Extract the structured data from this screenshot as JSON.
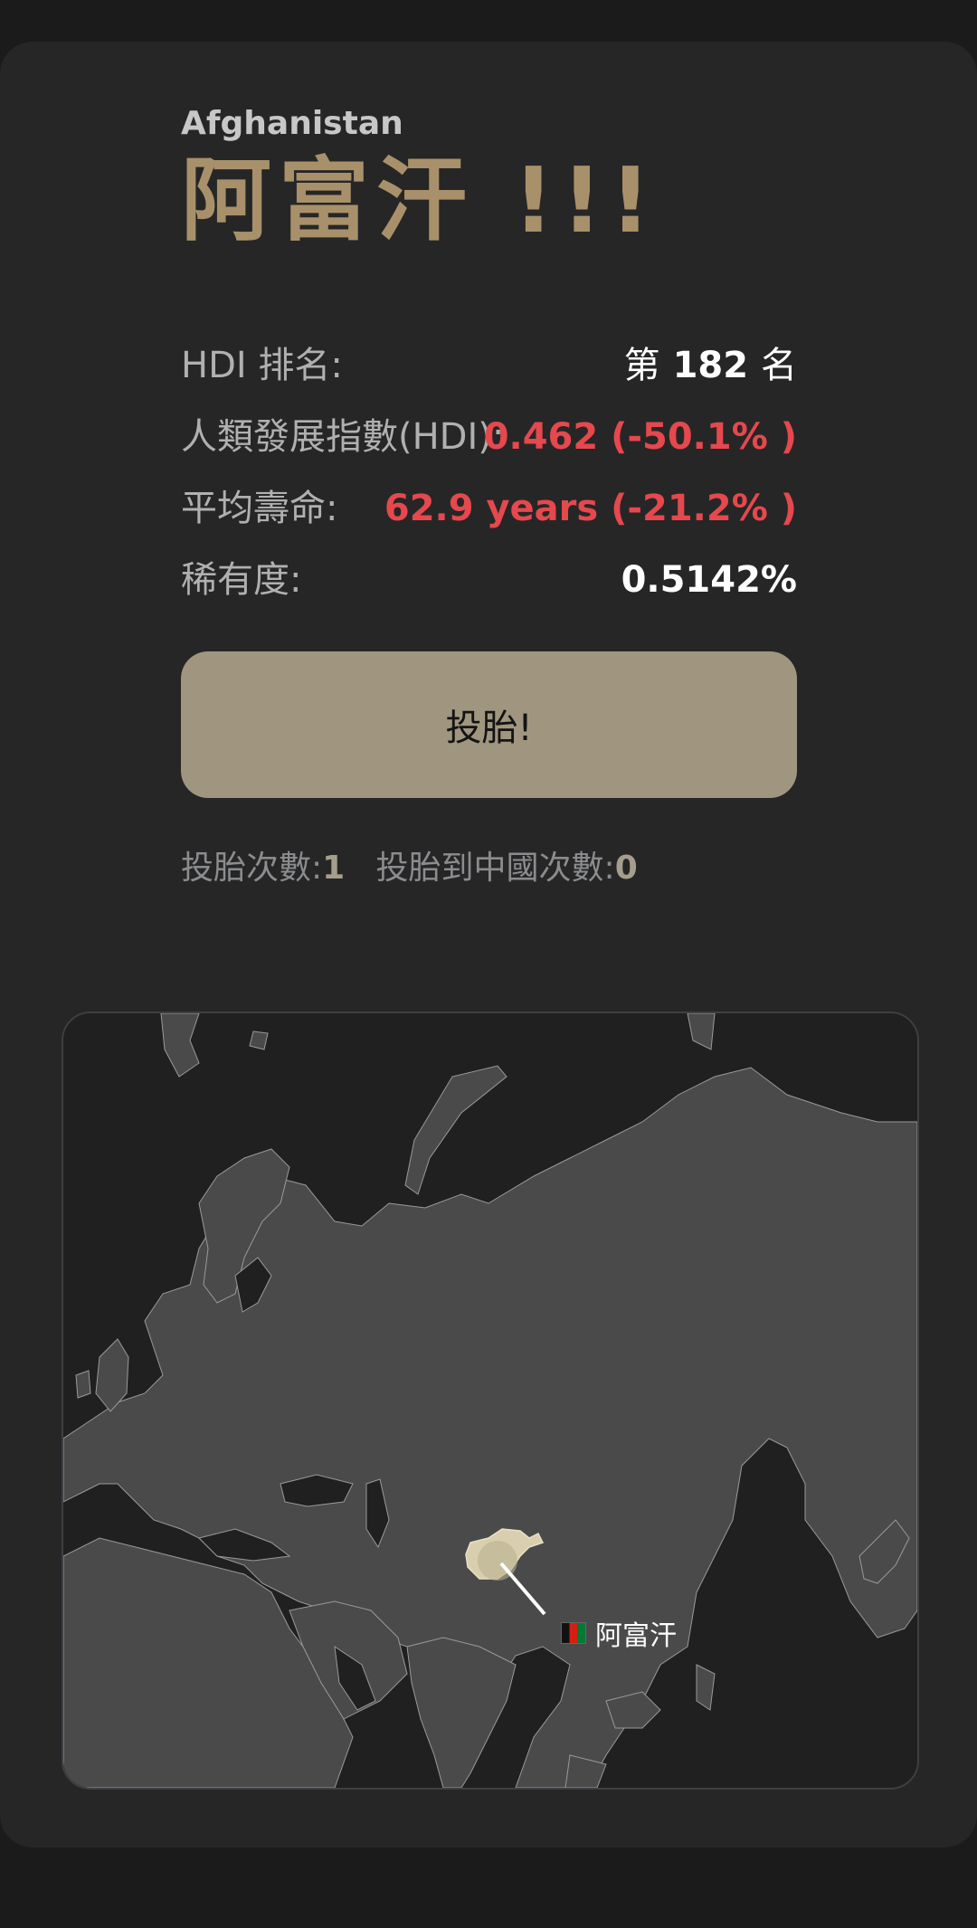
{
  "country": {
    "name_en": "Afghanistan",
    "name_zh": "阿富汗 !!!"
  },
  "stats": {
    "hdi_rank": {
      "label": "HDI 排名:",
      "prefix": "第",
      "value": "182",
      "suffix": "名"
    },
    "hdi": {
      "label": "人類發展指數(HDI):",
      "value": "0.462 (-50.1% )"
    },
    "life_expectancy": {
      "label": "平均壽命:",
      "value": "62.9 years (-21.2% )"
    },
    "rarity": {
      "label": "稀有度:",
      "value": "0.5142%"
    }
  },
  "action": {
    "reroll_label": "投胎!"
  },
  "counts": {
    "rolls_label": "投胎次數:",
    "rolls_value": "1",
    "china_label": "投胎到中國次數:",
    "china_value": "0"
  },
  "map": {
    "marker_label": "阿富汗",
    "highlight_color": "#d9cfae",
    "land_color": "#4a4a4b",
    "sea_color": "#202021",
    "border_color": "#9a9a9a"
  },
  "colors": {
    "accent_gold": "#a8916a",
    "negative_red": "#e5484d",
    "button_bg": "#a09680"
  }
}
